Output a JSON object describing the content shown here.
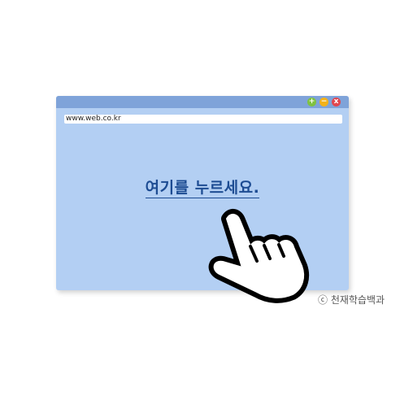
{
  "browser": {
    "url": "www.web.co.kr",
    "window_controls": {
      "maximize_label": "+",
      "minimize_label": "−",
      "close_label": "x"
    }
  },
  "content": {
    "link_text": "여기를 누르세요."
  },
  "copyright": "ⓒ 천재학습백과",
  "icons": {
    "cursor": "pointing-hand-icon"
  },
  "colors": {
    "titlebar": "#7fa3d9",
    "window_body": "#b3cff3",
    "link": "#1d4c93",
    "maximize": "#7fc241",
    "minimize": "#f3b21a",
    "close": "#e2474f"
  }
}
